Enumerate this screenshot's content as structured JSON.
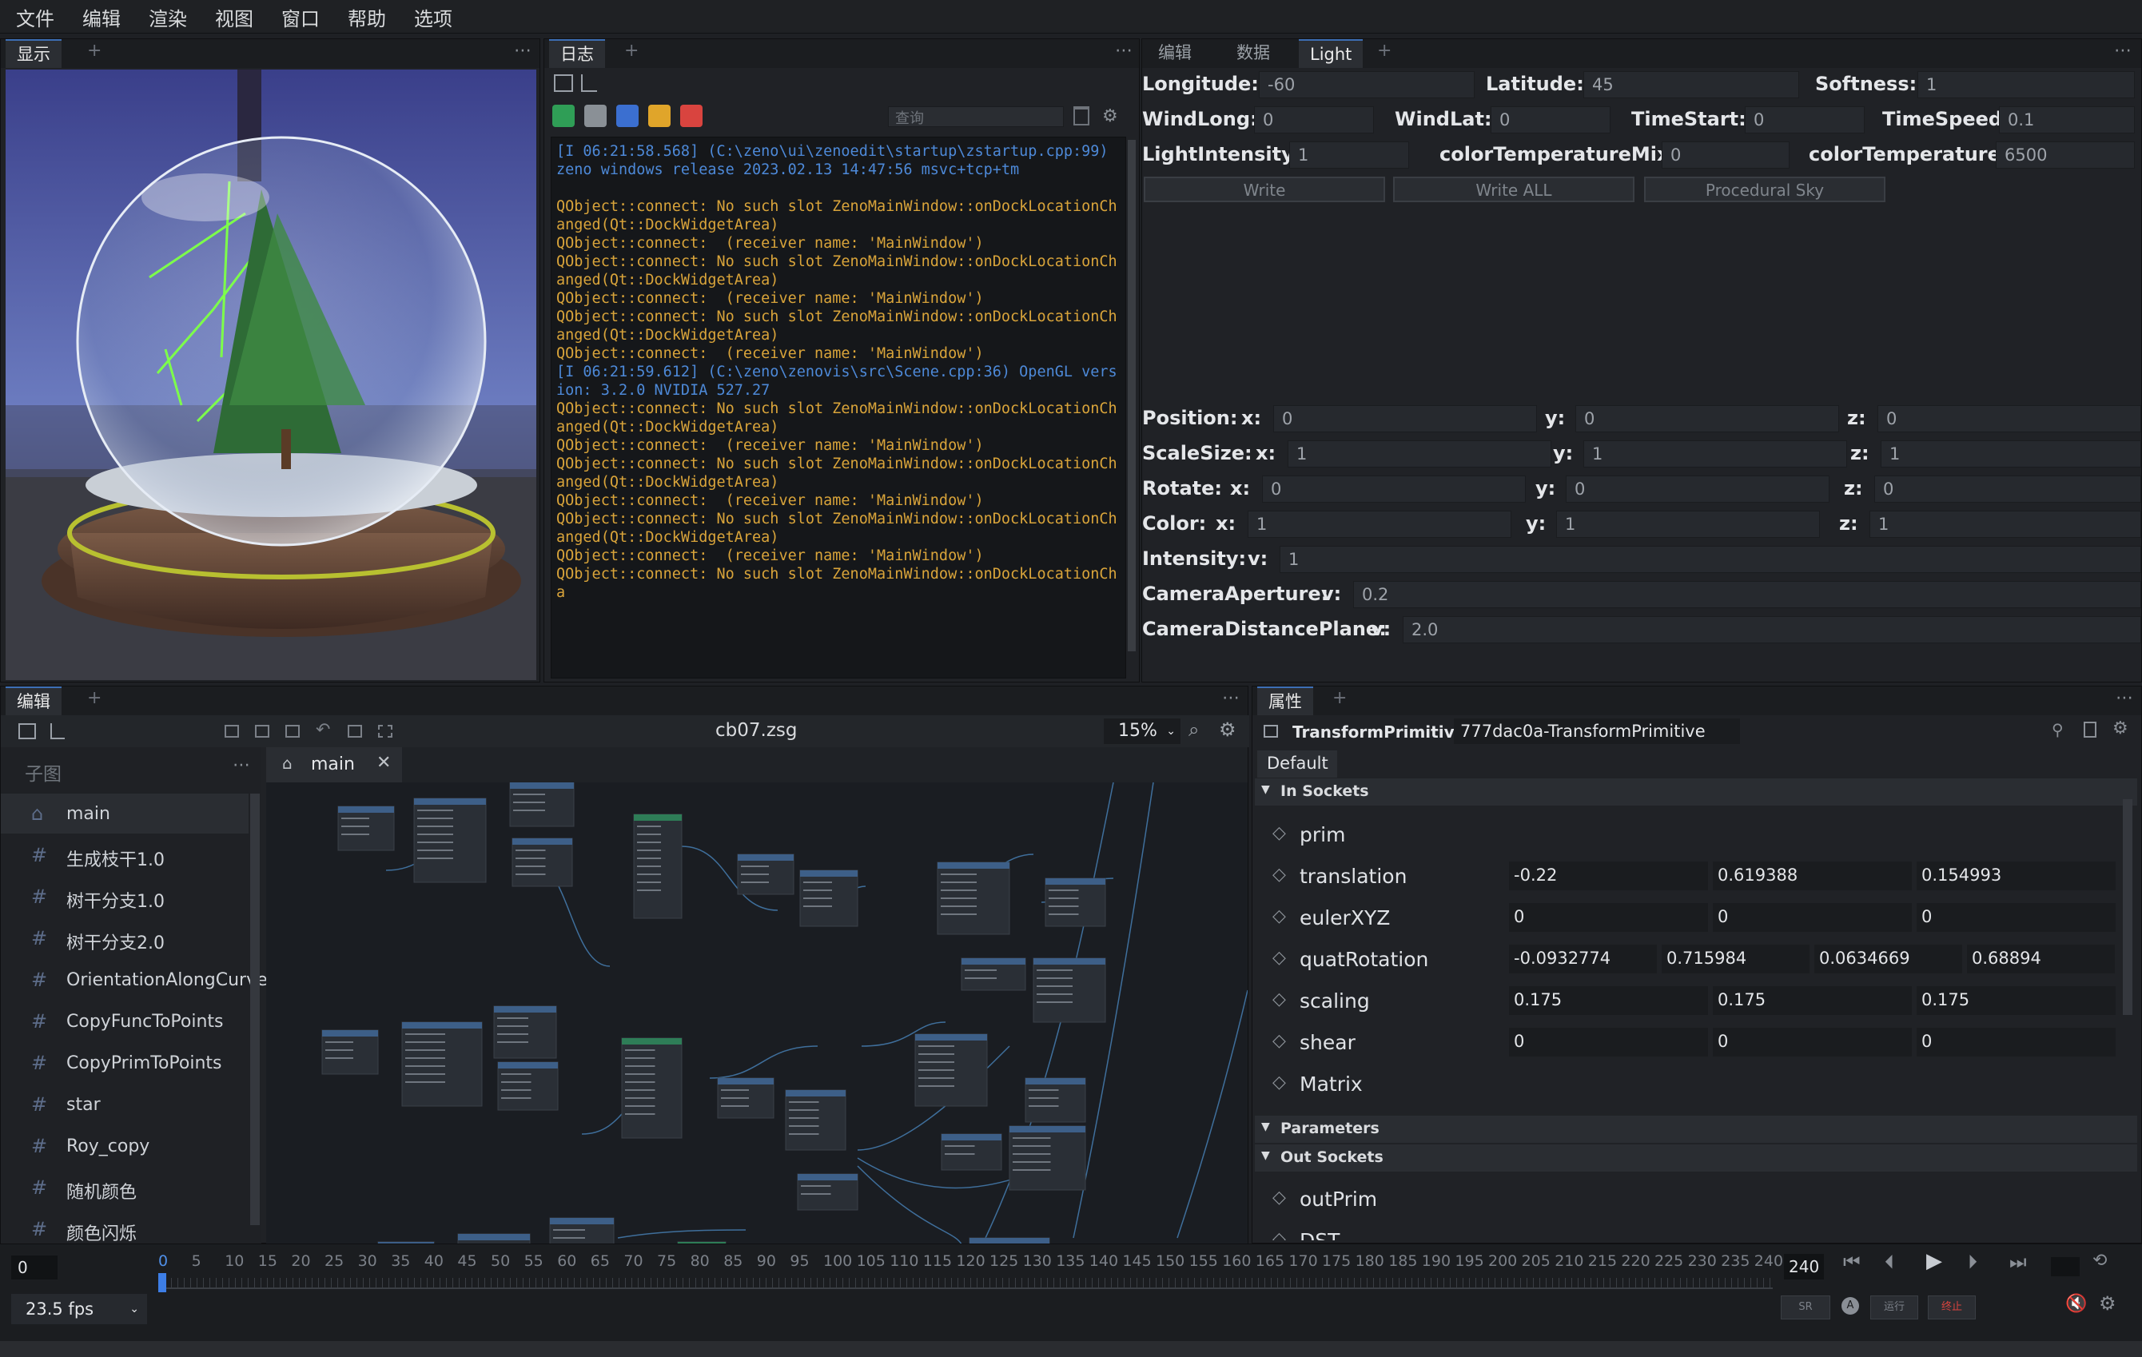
{
  "menu": [
    "文件",
    "编辑",
    "渲染",
    "视图",
    "窗口",
    "帮助",
    "选项"
  ],
  "display_panel": {
    "tab": "显示"
  },
  "log_panel": {
    "tab": "日志",
    "search_placeholder": "查询",
    "lines": [
      {
        "t": "info",
        "s": "[I 06:21:58.568] (C:\\zeno\\ui\\zenoedit\\startup\\zstartup.cpp:99) zeno windows release 2023.02.13 14:47:56 msvc+tcp+tm"
      },
      {
        "t": "blank",
        "s": " "
      },
      {
        "t": "warn",
        "s": "QObject::connect: No such slot ZenoMainWindow::onDockLocationChanged(Qt::DockWidgetArea)"
      },
      {
        "t": "warn",
        "s": "QObject::connect:  (receiver name: 'MainWindow')"
      },
      {
        "t": "warn",
        "s": "QObject::connect: No such slot ZenoMainWindow::onDockLocationChanged(Qt::DockWidgetArea)"
      },
      {
        "t": "warn",
        "s": "QObject::connect:  (receiver name: 'MainWindow')"
      },
      {
        "t": "warn",
        "s": "QObject::connect: No such slot ZenoMainWindow::onDockLocationChanged(Qt::DockWidgetArea)"
      },
      {
        "t": "warn",
        "s": "QObject::connect:  (receiver name: 'MainWindow')"
      },
      {
        "t": "info",
        "s": "[I 06:21:59.612] (C:\\zeno\\zenovis\\src\\Scene.cpp:36) OpenGL version: 3.2.0 NVIDIA 527.27"
      },
      {
        "t": "warn",
        "s": "QObject::connect: No such slot ZenoMainWindow::onDockLocationChanged(Qt::DockWidgetArea)"
      },
      {
        "t": "warn",
        "s": "QObject::connect:  (receiver name: 'MainWindow')"
      },
      {
        "t": "warn",
        "s": "QObject::connect: No such slot ZenoMainWindow::onDockLocationChanged(Qt::DockWidgetArea)"
      },
      {
        "t": "warn",
        "s": "QObject::connect:  (receiver name: 'MainWindow')"
      },
      {
        "t": "warn",
        "s": "QObject::connect: No such slot ZenoMainWindow::onDockLocationChanged(Qt::DockWidgetArea)"
      },
      {
        "t": "warn",
        "s": "QObject::connect:  (receiver name: 'MainWindow')"
      },
      {
        "t": "warn",
        "s": "QObject::connect: No such slot ZenoMainWindow::onDockLocationCha"
      }
    ]
  },
  "light_panel": {
    "tabs": [
      "编辑",
      "数据",
      "Light"
    ],
    "row1": {
      "longitude_l": "Longitude:",
      "longitude": "-60",
      "latitude_l": "Latitude:",
      "latitude": "45",
      "softness_l": "Softness:",
      "softness": "1"
    },
    "row2": {
      "windlong_l": "WindLong:",
      "windlong": "0",
      "windlat_l": "WindLat:",
      "windlat": "0",
      "timestart_l": "TimeStart:",
      "timestart": "0",
      "timespeed_l": "TimeSpeed:",
      "timespeed": "0.1"
    },
    "row3": {
      "intensity_l": "LightIntensity:",
      "intensity": "1",
      "mix_l": "colorTemperatureMix:",
      "mix": "0",
      "temp_l": "colorTemperature:",
      "temp": "6500"
    },
    "buttons": [
      "Write",
      "Write ALL",
      "Procedural Sky"
    ],
    "xform": [
      {
        "l": "Position:",
        "a": "x:",
        "x": "0",
        "b": "y:",
        "y": "0",
        "c": "z:",
        "z": "0"
      },
      {
        "l": "ScaleSize:",
        "a": "x:",
        "x": "1",
        "b": "y:",
        "y": "1",
        "c": "z:",
        "z": "1"
      },
      {
        "l": "Rotate:",
        "a": "x:",
        "x": "0",
        "b": "y:",
        "y": "0",
        "c": "z:",
        "z": "0"
      },
      {
        "l": "Color:",
        "a": "x:",
        "x": "1",
        "b": "y:",
        "y": "1",
        "c": "z:",
        "z": "1"
      }
    ],
    "single": [
      {
        "l": "Intensity:",
        "a": "v:",
        "v": "1"
      },
      {
        "l": "CameraAperture:",
        "a": "v:",
        "v": "0.2"
      },
      {
        "l": "CameraDistancePlane:",
        "a": "v:",
        "v": "2.0"
      }
    ]
  },
  "editor": {
    "tab": "编辑",
    "file": "cb07.zsg",
    "zoom": "15%",
    "subgraph_title": "子图",
    "graph_tab": "main",
    "subgraphs": [
      "main",
      "生成枝干1.0",
      "树干分支1.0",
      "树干分支2.0",
      "OrientationAlongCurve",
      "CopyFuncToPoints",
      "CopyPrimToPoints",
      "star",
      "Roy_copy",
      "随机颜色",
      "颜色闪烁"
    ]
  },
  "props": {
    "tab": "属性",
    "node_type": "TransformPrimitive",
    "node_id": "777dac0a-TransformPrimitive",
    "group": "Default",
    "in_sockets": "In Sockets",
    "parameters": "Parameters",
    "out_sockets": "Out Sockets",
    "rows": [
      {
        "name": "prim",
        "vals": []
      },
      {
        "name": "translation",
        "vals": [
          "-0.22",
          "0.619388",
          "0.154993"
        ]
      },
      {
        "name": "eulerXYZ",
        "vals": [
          "0",
          "0",
          "0"
        ]
      },
      {
        "name": "quatRotation",
        "vals": [
          "-0.0932774",
          "0.715984",
          "0.0634669",
          "0.68894"
        ]
      },
      {
        "name": "scaling",
        "vals": [
          "0.175",
          "0.175",
          "0.175"
        ]
      },
      {
        "name": "shear",
        "vals": [
          "0",
          "0",
          "0"
        ]
      },
      {
        "name": "Matrix",
        "vals": []
      }
    ],
    "out": [
      "outPrim",
      "DST"
    ]
  },
  "timeline": {
    "frame": "0",
    "fps": "23.5 fps",
    "end": "240",
    "ticks": [
      "0",
      "5",
      "10",
      "15",
      "20",
      "25",
      "30",
      "35",
      "40",
      "45",
      "50",
      "55",
      "60",
      "65",
      "70",
      "75",
      "80",
      "85",
      "90",
      "95",
      "100",
      "105",
      "110",
      "115",
      "120",
      "125",
      "130",
      "135",
      "140",
      "145",
      "150",
      "155",
      "160",
      "165",
      "170",
      "175",
      "180",
      "185",
      "190",
      "195",
      "200",
      "205",
      "210",
      "215",
      "220",
      "225",
      "230",
      "235",
      "240"
    ],
    "sr": "SR",
    "a": "A",
    "run": "运行",
    "stop": "终止"
  }
}
